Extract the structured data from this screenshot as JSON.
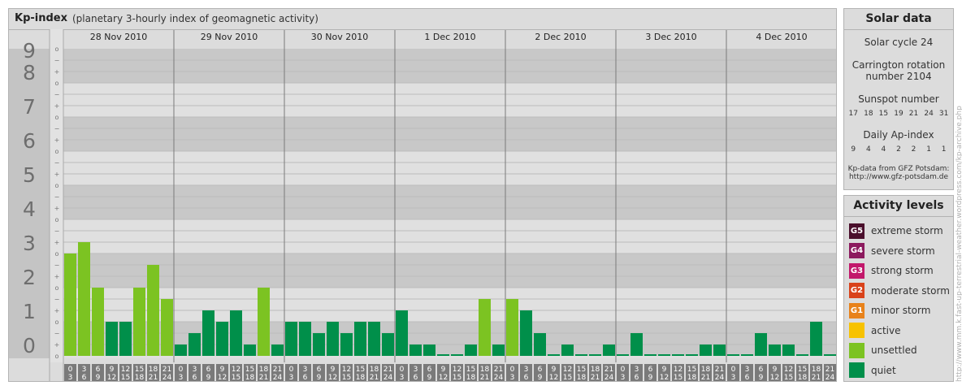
{
  "header": {
    "title": "Kp-index",
    "subtitle": "(planetary 3-hourly index of geomagnetic activity)"
  },
  "chart_data": {
    "type": "bar",
    "title": "Kp-index",
    "subtitle": "(planetary 3-hourly index of geomagnetic activity)",
    "ylim": [
      0,
      9
    ],
    "y_ticks": [
      "0",
      "1",
      "2",
      "3",
      "4",
      "5",
      "6",
      "7",
      "8",
      "9"
    ],
    "subticks": [
      "o",
      "+",
      "−",
      "o",
      "+",
      "−",
      "o",
      "+",
      "−",
      "o",
      "+",
      "−",
      "o",
      "+",
      "−",
      "o",
      "+",
      "−",
      "o",
      "+",
      "−",
      "o",
      "+",
      "−",
      "o",
      "+",
      "−",
      "o"
    ],
    "days": [
      "28 Nov 2010",
      "29 Nov 2010",
      "30 Nov 2010",
      "1 Dec 2010",
      "2 Dec 2010",
      "3 Dec 2010",
      "4 Dec 2010"
    ],
    "hour_start": [
      "0",
      "3",
      "6",
      "9",
      "12",
      "15",
      "18",
      "21"
    ],
    "hour_end": [
      "3",
      "6",
      "9",
      "12",
      "15",
      "18",
      "21",
      "24"
    ],
    "values": [
      3.0,
      3.333,
      2.0,
      1.0,
      1.0,
      2.0,
      2.667,
      1.667,
      0.333,
      0.667,
      1.333,
      1.0,
      1.333,
      0.333,
      2.0,
      0.333,
      1.0,
      1.0,
      0.667,
      1.0,
      0.667,
      1.0,
      1.0,
      0.667,
      1.333,
      0.333,
      0.333,
      0.0,
      0.0,
      0.333,
      1.667,
      0.333,
      1.667,
      1.333,
      0.667,
      0.0,
      0.333,
      0.0,
      0.0,
      0.333,
      0.0,
      0.667,
      0.0,
      0.0,
      0.0,
      0.0,
      0.333,
      0.333,
      0.0,
      0.0,
      0.667,
      0.333,
      0.333,
      0.0,
      1.0,
      0.0
    ],
    "levels": [
      "unsettled",
      "unsettled",
      "unsettled",
      "quiet",
      "quiet",
      "unsettled",
      "unsettled",
      "unsettled",
      "quiet",
      "quiet",
      "quiet",
      "quiet",
      "quiet",
      "quiet",
      "unsettled",
      "quiet",
      "quiet",
      "quiet",
      "quiet",
      "quiet",
      "quiet",
      "quiet",
      "quiet",
      "quiet",
      "quiet",
      "quiet",
      "quiet",
      "quiet",
      "quiet",
      "quiet",
      "unsettled",
      "quiet",
      "unsettled",
      "quiet",
      "quiet",
      "quiet",
      "quiet",
      "quiet",
      "quiet",
      "quiet",
      "quiet",
      "quiet",
      "quiet",
      "quiet",
      "quiet",
      "quiet",
      "quiet",
      "quiet",
      "quiet",
      "quiet",
      "quiet",
      "quiet",
      "quiet",
      "quiet",
      "quiet",
      "quiet"
    ]
  },
  "solar": {
    "title": "Solar data",
    "cycle": "Solar cycle 24",
    "carrington_line1": "Carrington rotation",
    "carrington_line2": "number 2104",
    "sunspot_label": "Sunspot number",
    "sunspot_values": [
      "17",
      "18",
      "15",
      "19",
      "21",
      "24",
      "31"
    ],
    "ap_label": "Daily Ap-index",
    "ap_values": [
      "9",
      "4",
      "4",
      "2",
      "2",
      "1",
      "1"
    ],
    "source_line1": "Kp-data from GFZ Potsdam:",
    "source_line2": "http://www.gfz-potsdam.de"
  },
  "activity": {
    "title": "Activity levels",
    "levels": [
      {
        "code": "G5",
        "label": "extreme storm",
        "color": "#4a0f2c"
      },
      {
        "code": "G4",
        "label": "severe storm",
        "color": "#8c1a5e"
      },
      {
        "code": "G3",
        "label": "strong storm",
        "color": "#c2186b"
      },
      {
        "code": "G2",
        "label": "moderate storm",
        "color": "#d9421a"
      },
      {
        "code": "G1",
        "label": "minor storm",
        "color": "#e8821a"
      },
      {
        "code": "",
        "label": "active",
        "color": "#f7c200"
      },
      {
        "code": "",
        "label": "unsettled",
        "color": "#7cc322"
      },
      {
        "code": "",
        "label": "quiet",
        "color": "#008f4a"
      }
    ]
  },
  "colors": {
    "quiet": "#008f4a",
    "unsettled": "#7cc322",
    "band_dark": "#c8c8c8",
    "band_light": "#e0e0e0",
    "number_col": "#c4c4c4",
    "hour_cell": "#7a7a7a"
  },
  "credit": "http://www.mm.k.fast-up-terrestrial-weather.wordpress.com/kp-archive.php"
}
